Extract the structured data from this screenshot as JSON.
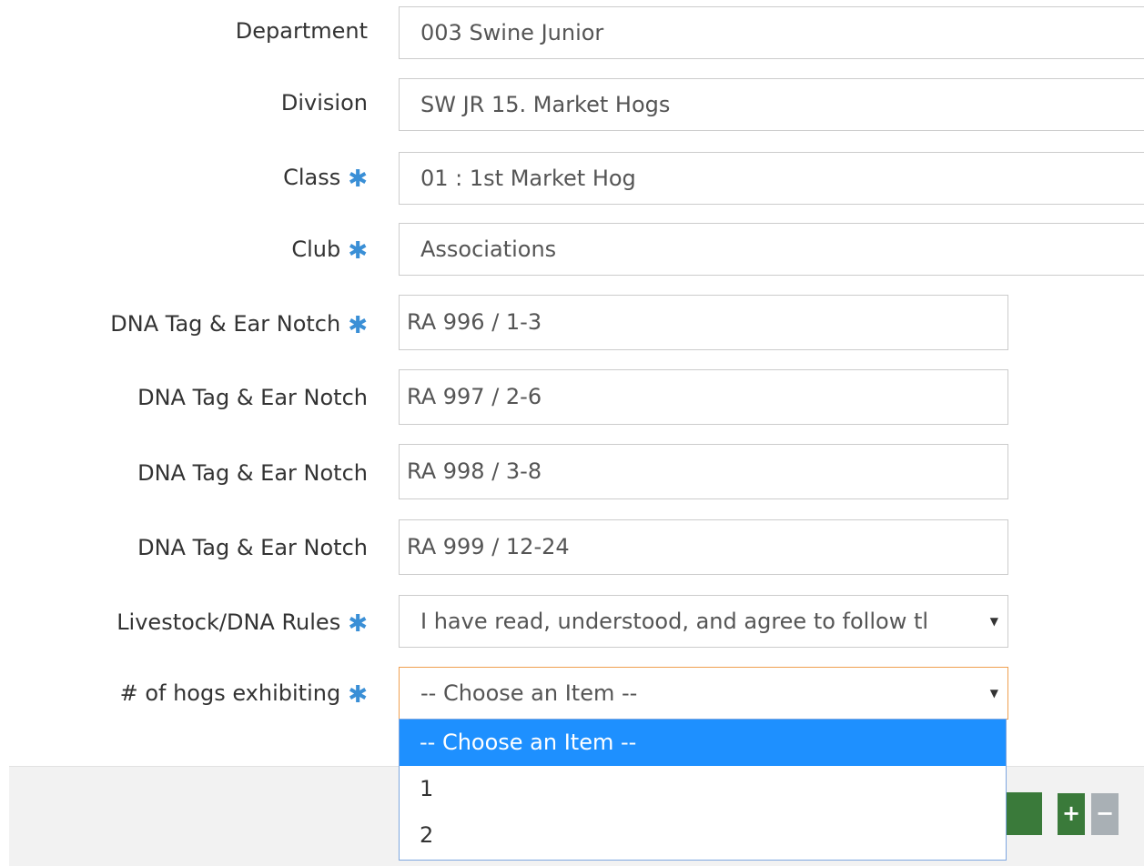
{
  "form": {
    "department": {
      "label": "Department",
      "value": "003 Swine Junior"
    },
    "division": {
      "label": "Division",
      "value": "SW JR 15. Market Hogs"
    },
    "class": {
      "label": "Class",
      "value": "01 : 1st Market Hog"
    },
    "club": {
      "label": "Club",
      "value": "Associations"
    },
    "dna1": {
      "label": "DNA Tag & Ear Notch",
      "value": "RA 996 / 1-3"
    },
    "dna2": {
      "label": "DNA Tag & Ear Notch",
      "value": "RA 997 / 2-6"
    },
    "dna3": {
      "label": "DNA Tag & Ear Notch",
      "value": "RA 998 / 3-8"
    },
    "dna4": {
      "label": "DNA Tag & Ear Notch",
      "value": "RA 999 / 12-24"
    },
    "rules": {
      "label": "Livestock/DNA Rules",
      "value": "I have read, understood, and agree to follow tl"
    },
    "hogs": {
      "label": "# of hogs exhibiting",
      "value": "-- Choose an Item --",
      "options": [
        "-- Choose an Item --",
        "1",
        "2"
      ]
    }
  },
  "required_marker": "✱",
  "footer": {
    "plus_label": "+",
    "minus_label": "−"
  },
  "colors": {
    "accent": "#1e90ff",
    "required": "#3a8fd6",
    "focus_border": "#f0a050",
    "green": "#3a7a3a"
  }
}
